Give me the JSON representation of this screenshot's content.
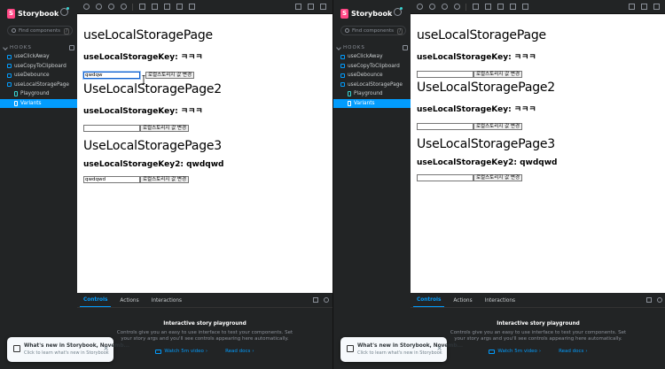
{
  "brand": {
    "name": "Storybook",
    "logo_letter": "S",
    "accent": "#ff4785"
  },
  "search": {
    "placeholder": "Find components",
    "shortcut": "/"
  },
  "sidebar": {
    "group_label": "HOOKS",
    "items": [
      {
        "label": "useClickAway"
      },
      {
        "label": "useCopyToClipboard"
      },
      {
        "label": "useDebounce"
      },
      {
        "label": "useLocalStoragePage"
      },
      {
        "label": "Playground"
      },
      {
        "label": "Variants"
      }
    ],
    "selected_color": "#029cfd"
  },
  "canvas": {
    "sections": [
      {
        "title": "useLocalStoragePage",
        "key_label": "useLocalStorageKey: ㅋㅋㅋ",
        "button_label": "로컬스토리지 값 변경"
      },
      {
        "title": "UseLocalStoragePage2",
        "key_label": "useLocalStorageKey: ㅋㅋㅋ",
        "button_label": "로컬스토리지 값 변경"
      },
      {
        "title": "UseLocalStoragePage3",
        "key_label": "useLocalStorageKey2: qwdqwd",
        "button_label": "로컬스토리지 값 변경"
      }
    ]
  },
  "panels": [
    {
      "inputs": [
        "qwdqw",
        "",
        "qwdqwd"
      ]
    },
    {
      "inputs": [
        "",
        "",
        ""
      ]
    }
  ],
  "addons": {
    "tabs": [
      "Controls",
      "Actions",
      "Interactions"
    ],
    "playground_title": "Interactive story playground",
    "playground_desc": "Controls give you an easy to use interface to test your components. Set your story args and you'll see controls appearing here automatically.",
    "link_video": "Watch 5m video",
    "link_docs": "Read docs"
  },
  "notification": {
    "title": "What's new in Storybook, Novemb...",
    "subtitle": "Click to learn what's new in Storybook"
  }
}
